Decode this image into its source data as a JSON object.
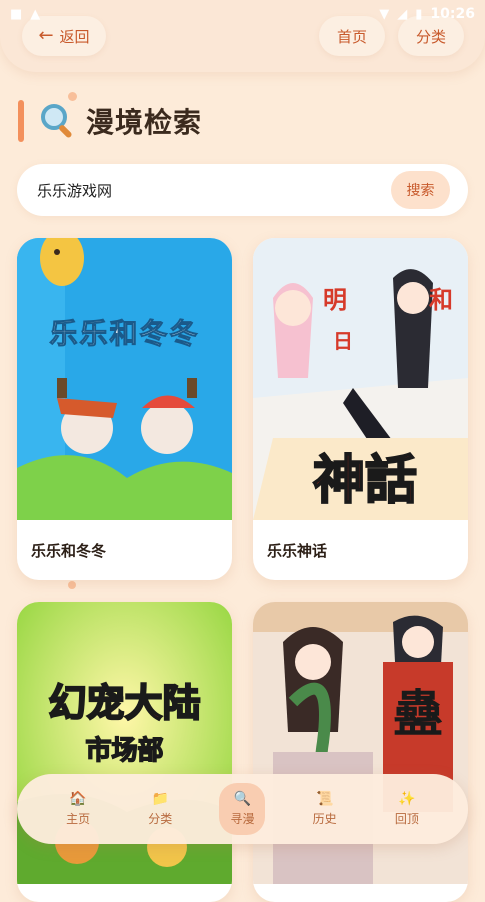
{
  "status": {
    "time": "10:26"
  },
  "header": {
    "back_label": "返回",
    "home_label": "首页",
    "category_label": "分类"
  },
  "page": {
    "title": "漫境检索"
  },
  "search": {
    "value": "乐乐游戏网",
    "button_label": "搜索"
  },
  "results": [
    {
      "title": "乐乐和冬冬",
      "cover_text": "乐乐和冬冬"
    },
    {
      "title": "乐乐神话",
      "cover_text": "神話"
    },
    {
      "title": "",
      "cover_text": "幻宠大陆",
      "cover_subtext": "市场部"
    },
    {
      "title": "",
      "cover_text": "蠱"
    }
  ],
  "nav": {
    "items": [
      {
        "label": "主页",
        "icon": "home-icon"
      },
      {
        "label": "分类",
        "icon": "folder-icon"
      },
      {
        "label": "寻漫",
        "icon": "search-icon",
        "active": true
      },
      {
        "label": "历史",
        "icon": "scroll-icon"
      },
      {
        "label": "回顶",
        "icon": "sparkle-icon"
      }
    ]
  },
  "colors": {
    "accent": "#f3905c",
    "background": "#fdebd9",
    "button_text": "#c85a2c"
  }
}
